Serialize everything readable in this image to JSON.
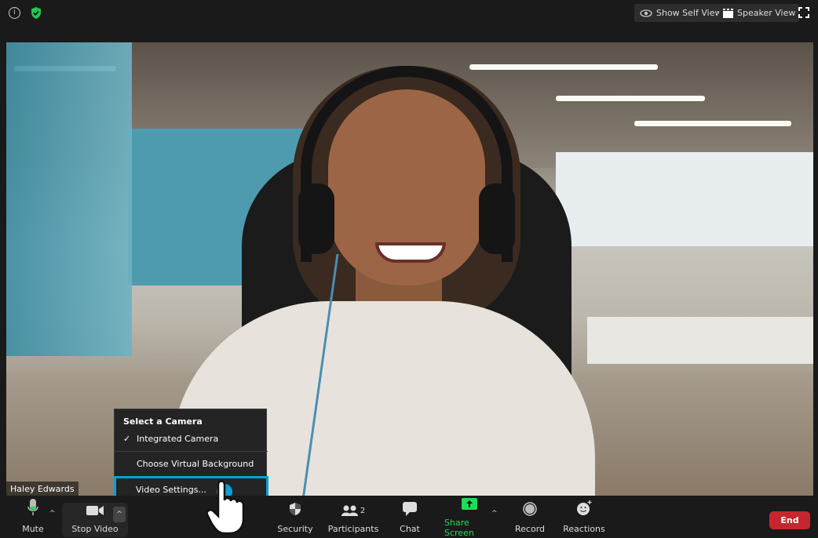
{
  "topbar": {
    "show_self_view": "Show Self View",
    "speaker_view": "Speaker View"
  },
  "video": {
    "participant_name": "Haley Edwards"
  },
  "camera_menu": {
    "heading": "Select a Camera",
    "items": [
      {
        "label": "Integrated Camera",
        "checked": true
      },
      {
        "label": "Choose Virtual Background"
      },
      {
        "label": "Video Settings..."
      }
    ],
    "highlight_color": "#0aa0d8"
  },
  "toolbar": {
    "mute": "Mute",
    "stop_video": "Stop Video",
    "security": "Security",
    "participants": "Participants",
    "participants_count": "2",
    "chat": "Chat",
    "share_screen": "Share Screen",
    "record": "Record",
    "reactions": "Reactions",
    "end": "End",
    "share_color": "#23d959",
    "end_color": "#c6262e"
  }
}
